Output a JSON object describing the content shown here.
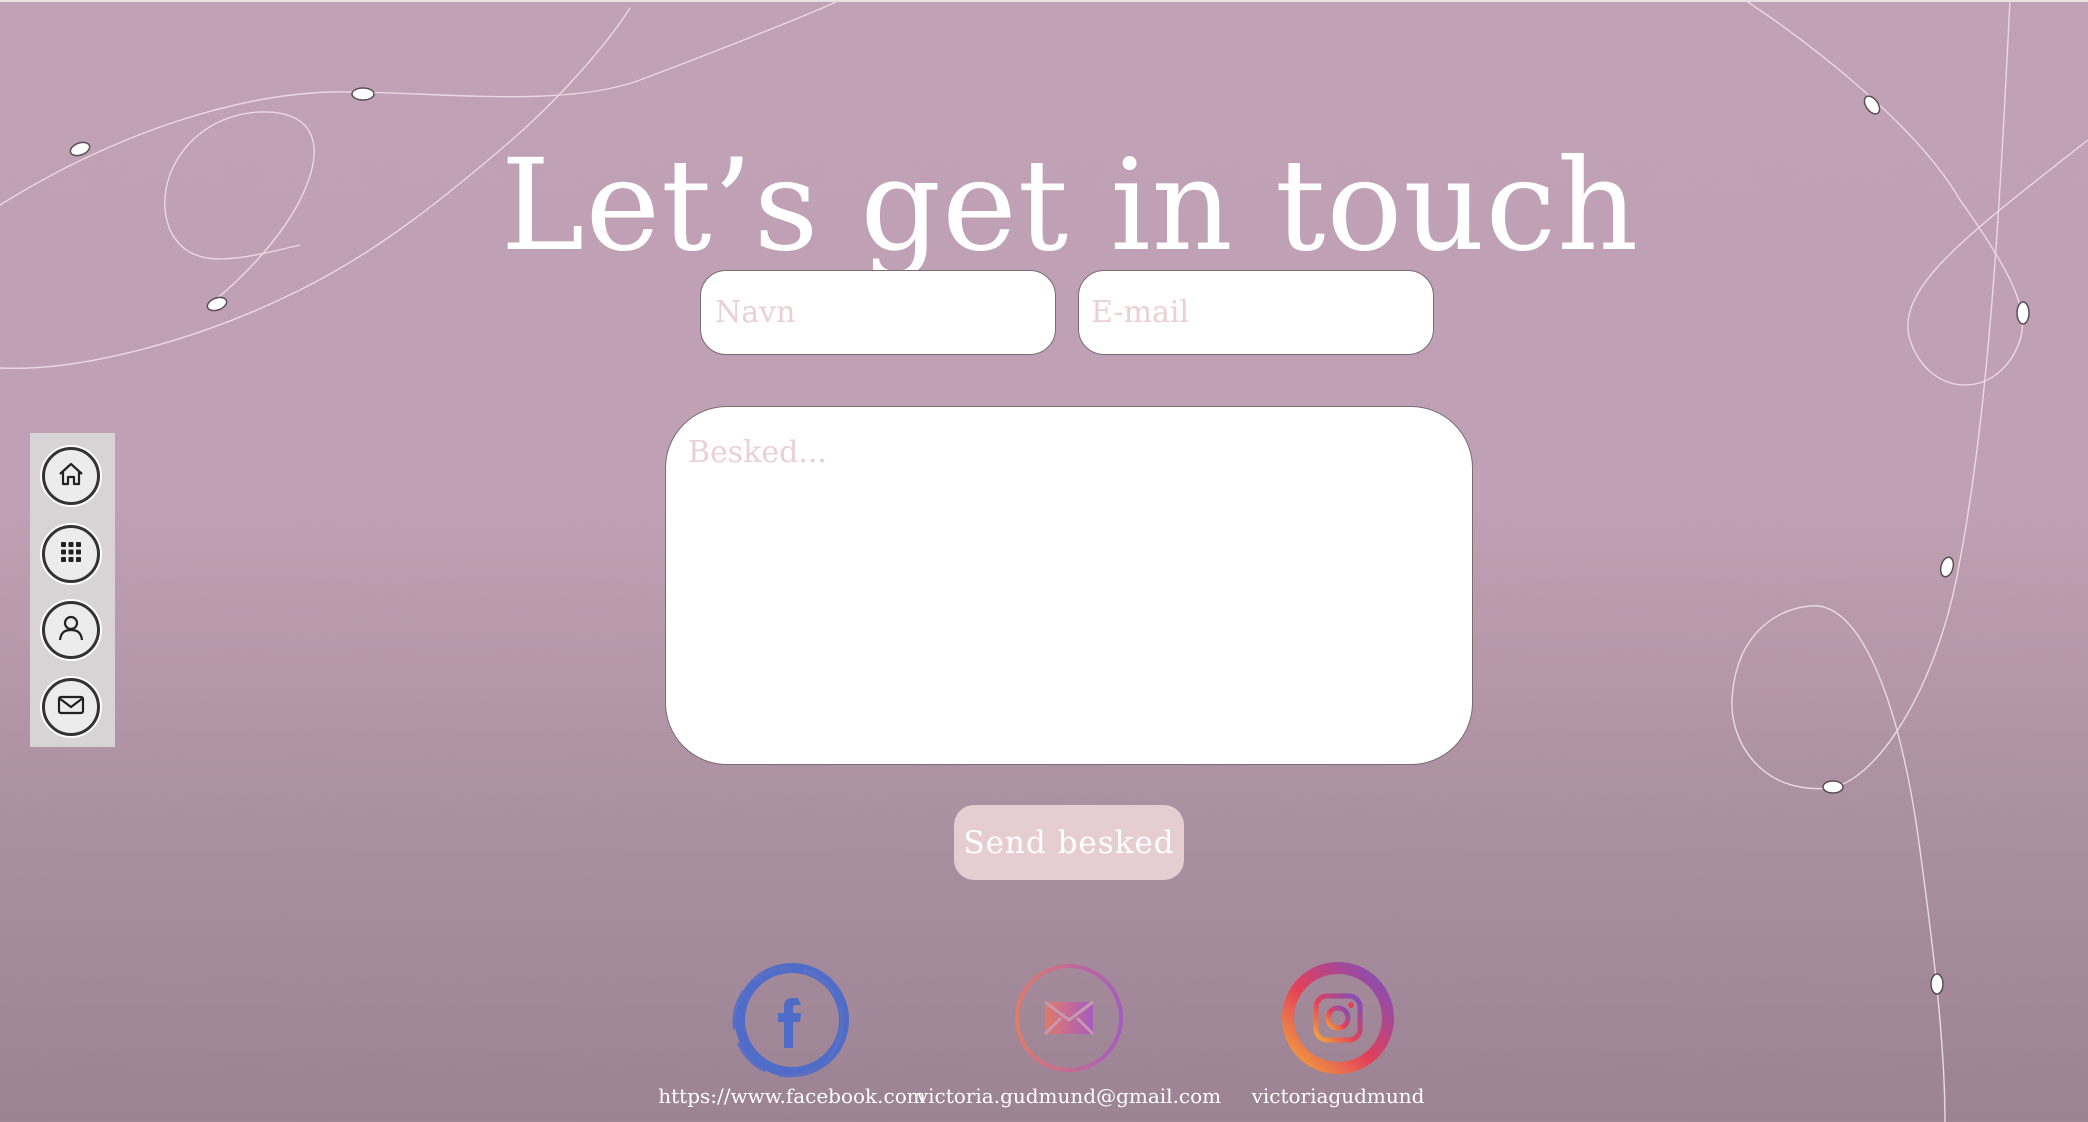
{
  "page": {
    "title": "Let’s get in touch"
  },
  "form": {
    "name_placeholder": "Navn",
    "email_placeholder": "E-mail",
    "message_placeholder": "Besked...",
    "submit_label": "Send besked"
  },
  "side_nav": {
    "items": [
      {
        "icon": "home-icon"
      },
      {
        "icon": "grid-icon"
      },
      {
        "icon": "user-icon"
      },
      {
        "icon": "mail-icon"
      }
    ]
  },
  "social": {
    "facebook": {
      "label": "https://www.facebook.com",
      "icon": "facebook-icon"
    },
    "email": {
      "label": "victoria.gudmund@gmail.com",
      "icon": "envelope-icon"
    },
    "instagram": {
      "label": "victoriagudmund",
      "icon": "instagram-icon"
    }
  },
  "colors": {
    "background_top": "#c1a1b5",
    "background_bottom": "#9c8393",
    "button": "#e6cdd2",
    "placeholder": "#ead0d3"
  }
}
